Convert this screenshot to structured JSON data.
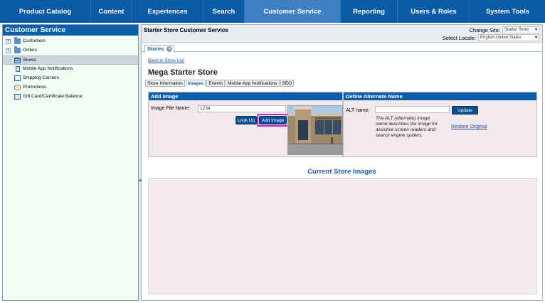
{
  "topnav": {
    "items": [
      "Product Catalog",
      "Content",
      "Experiences",
      "Search",
      "Customer Service",
      "Reporting",
      "Users & Roles",
      "System Tools"
    ],
    "active": "Customer Service"
  },
  "sidebar": {
    "title": "Customer Service",
    "items": [
      {
        "label": "Customers",
        "expander": "+"
      },
      {
        "label": "Orders",
        "expander": "+"
      },
      {
        "label": "Stores"
      },
      {
        "label": "Mobile App Notifications"
      },
      {
        "label": "Shipping Carriers"
      },
      {
        "label": "Promotions"
      },
      {
        "label": "Gift Card/Certificate Balance"
      }
    ],
    "selected": "Stores",
    "splitter_glyph": "◂"
  },
  "main": {
    "title": "Starter Store Customer Service",
    "change_site_label": "Change Site:",
    "change_site_value": "Starter Store",
    "select_locale_label": "Select Locale:",
    "select_locale_value": "English-United States",
    "doc_tab_label": "Stores",
    "doc_tab_close": "×",
    "back_link": "Back to Store List",
    "store_name": "Mega Starter Store",
    "subtabs": [
      "Store Information",
      "Images",
      "Events",
      "Mobile App Notifications",
      "SEO"
    ],
    "active_subtab": "Images",
    "add_image": {
      "header": "Add Image",
      "file_label": "Image File Name:",
      "file_value": "1234",
      "lookup_label": "Look Up",
      "add_label": "Add Image"
    },
    "alt_name": {
      "header": "Define Alternate Name",
      "label": "ALT name:",
      "value": "",
      "update_label": "Update",
      "help_lines": [
        "The ALT (alternate) image",
        "name describes the image for",
        "assistive screen readers and",
        "search engine spiders."
      ],
      "restore_label": "Restore Original"
    },
    "current_images_title": "Current Store Images"
  },
  "colors": {
    "nav_bg": "#0a5aa5",
    "nav_active": "#3f7fc2",
    "box_bg": "#f3e8ea",
    "header_blue": "#0b5ea7",
    "highlight": "#d020c8"
  }
}
